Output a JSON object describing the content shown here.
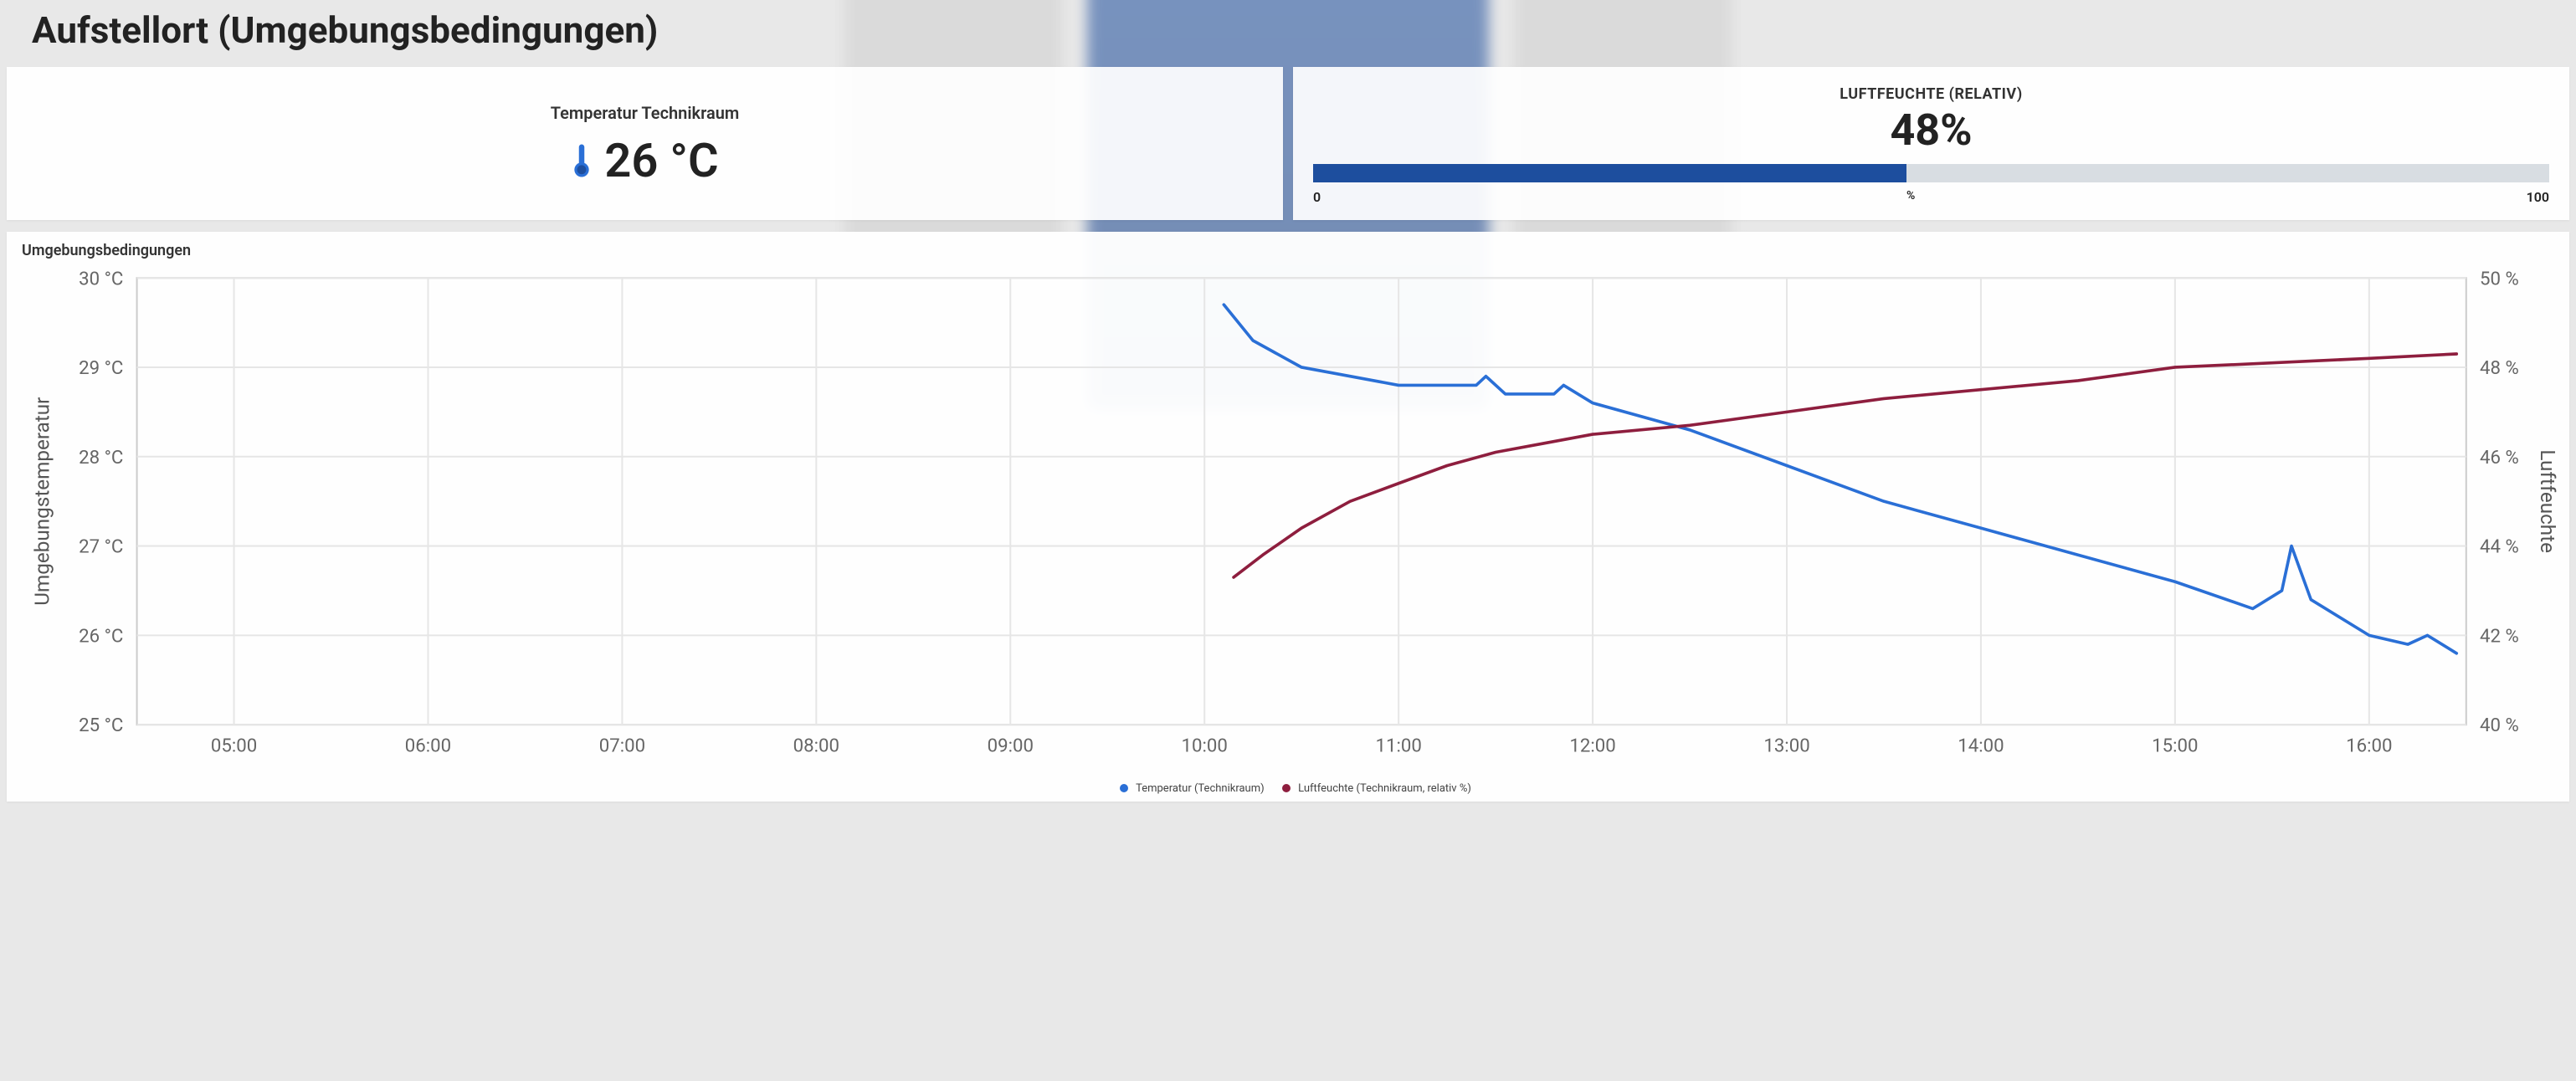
{
  "title": "Aufstellort (Umgebungsbedingungen)",
  "temp_panel": {
    "label": "Temperatur Technikraum",
    "value": "26 °C"
  },
  "hum_panel": {
    "title": "LUFTFEUCHTE (RELATIV)",
    "value": "48%",
    "percent": 48,
    "min_label": "0",
    "max_label": "100",
    "unit": "%"
  },
  "chart_panel": {
    "title": "Umgebungsbedingungen",
    "legend": {
      "temp": "Temperatur (Technikraum)",
      "hum": "Luftfeuchte (Technikraum, relativ %)"
    },
    "y1_title": "Umgebungstemperatur",
    "y2_title": "Luftfeuchte"
  },
  "colors": {
    "temp": "#2a6fd6",
    "hum": "#8e1e3e",
    "grid": "#e6e6e6"
  },
  "chart_data": {
    "type": "line",
    "title": "Umgebungsbedingungen",
    "xlabel": "",
    "x_ticks": [
      "05:00",
      "06:00",
      "07:00",
      "08:00",
      "09:00",
      "10:00",
      "11:00",
      "12:00",
      "13:00",
      "14:00",
      "15:00",
      "16:00"
    ],
    "y1": {
      "label": "Umgebungstemperatur",
      "unit": "°C",
      "min": 25,
      "max": 30,
      "ticks": [
        25,
        26,
        27,
        28,
        29,
        30
      ]
    },
    "y2": {
      "label": "Luftfeuchte",
      "unit": "%",
      "min": 40,
      "max": 50,
      "ticks": [
        40,
        42,
        44,
        46,
        48,
        50
      ]
    },
    "series": [
      {
        "name": "Temperatur (Technikraum)",
        "axis": "y1",
        "color": "#2a6fd6",
        "points": [
          {
            "x": 10.1,
            "y": 29.7
          },
          {
            "x": 10.25,
            "y": 29.3
          },
          {
            "x": 10.5,
            "y": 29.0
          },
          {
            "x": 10.75,
            "y": 28.9
          },
          {
            "x": 11.0,
            "y": 28.8
          },
          {
            "x": 11.4,
            "y": 28.8
          },
          {
            "x": 11.45,
            "y": 28.9
          },
          {
            "x": 11.55,
            "y": 28.7
          },
          {
            "x": 11.8,
            "y": 28.7
          },
          {
            "x": 11.85,
            "y": 28.8
          },
          {
            "x": 12.0,
            "y": 28.6
          },
          {
            "x": 12.5,
            "y": 28.3
          },
          {
            "x": 13.0,
            "y": 27.9
          },
          {
            "x": 13.5,
            "y": 27.5
          },
          {
            "x": 14.0,
            "y": 27.2
          },
          {
            "x": 14.5,
            "y": 26.9
          },
          {
            "x": 15.0,
            "y": 26.6
          },
          {
            "x": 15.4,
            "y": 26.3
          },
          {
            "x": 15.55,
            "y": 26.5
          },
          {
            "x": 15.6,
            "y": 27.0
          },
          {
            "x": 15.7,
            "y": 26.4
          },
          {
            "x": 16.0,
            "y": 26.0
          },
          {
            "x": 16.2,
            "y": 25.9
          },
          {
            "x": 16.3,
            "y": 26.0
          },
          {
            "x": 16.45,
            "y": 25.8
          }
        ]
      },
      {
        "name": "Luftfeuchte (Technikraum, relativ %)",
        "axis": "y2",
        "color": "#8e1e3e",
        "points": [
          {
            "x": 10.15,
            "y": 43.3
          },
          {
            "x": 10.3,
            "y": 43.8
          },
          {
            "x": 10.5,
            "y": 44.4
          },
          {
            "x": 10.75,
            "y": 45.0
          },
          {
            "x": 11.0,
            "y": 45.4
          },
          {
            "x": 11.25,
            "y": 45.8
          },
          {
            "x": 11.5,
            "y": 46.1
          },
          {
            "x": 11.75,
            "y": 46.3
          },
          {
            "x": 12.0,
            "y": 46.5
          },
          {
            "x": 12.5,
            "y": 46.7
          },
          {
            "x": 13.0,
            "y": 47.0
          },
          {
            "x": 13.5,
            "y": 47.3
          },
          {
            "x": 14.0,
            "y": 47.5
          },
          {
            "x": 14.5,
            "y": 47.7
          },
          {
            "x": 15.0,
            "y": 48.0
          },
          {
            "x": 15.5,
            "y": 48.1
          },
          {
            "x": 16.0,
            "y": 48.2
          },
          {
            "x": 16.45,
            "y": 48.3
          }
        ]
      }
    ]
  }
}
